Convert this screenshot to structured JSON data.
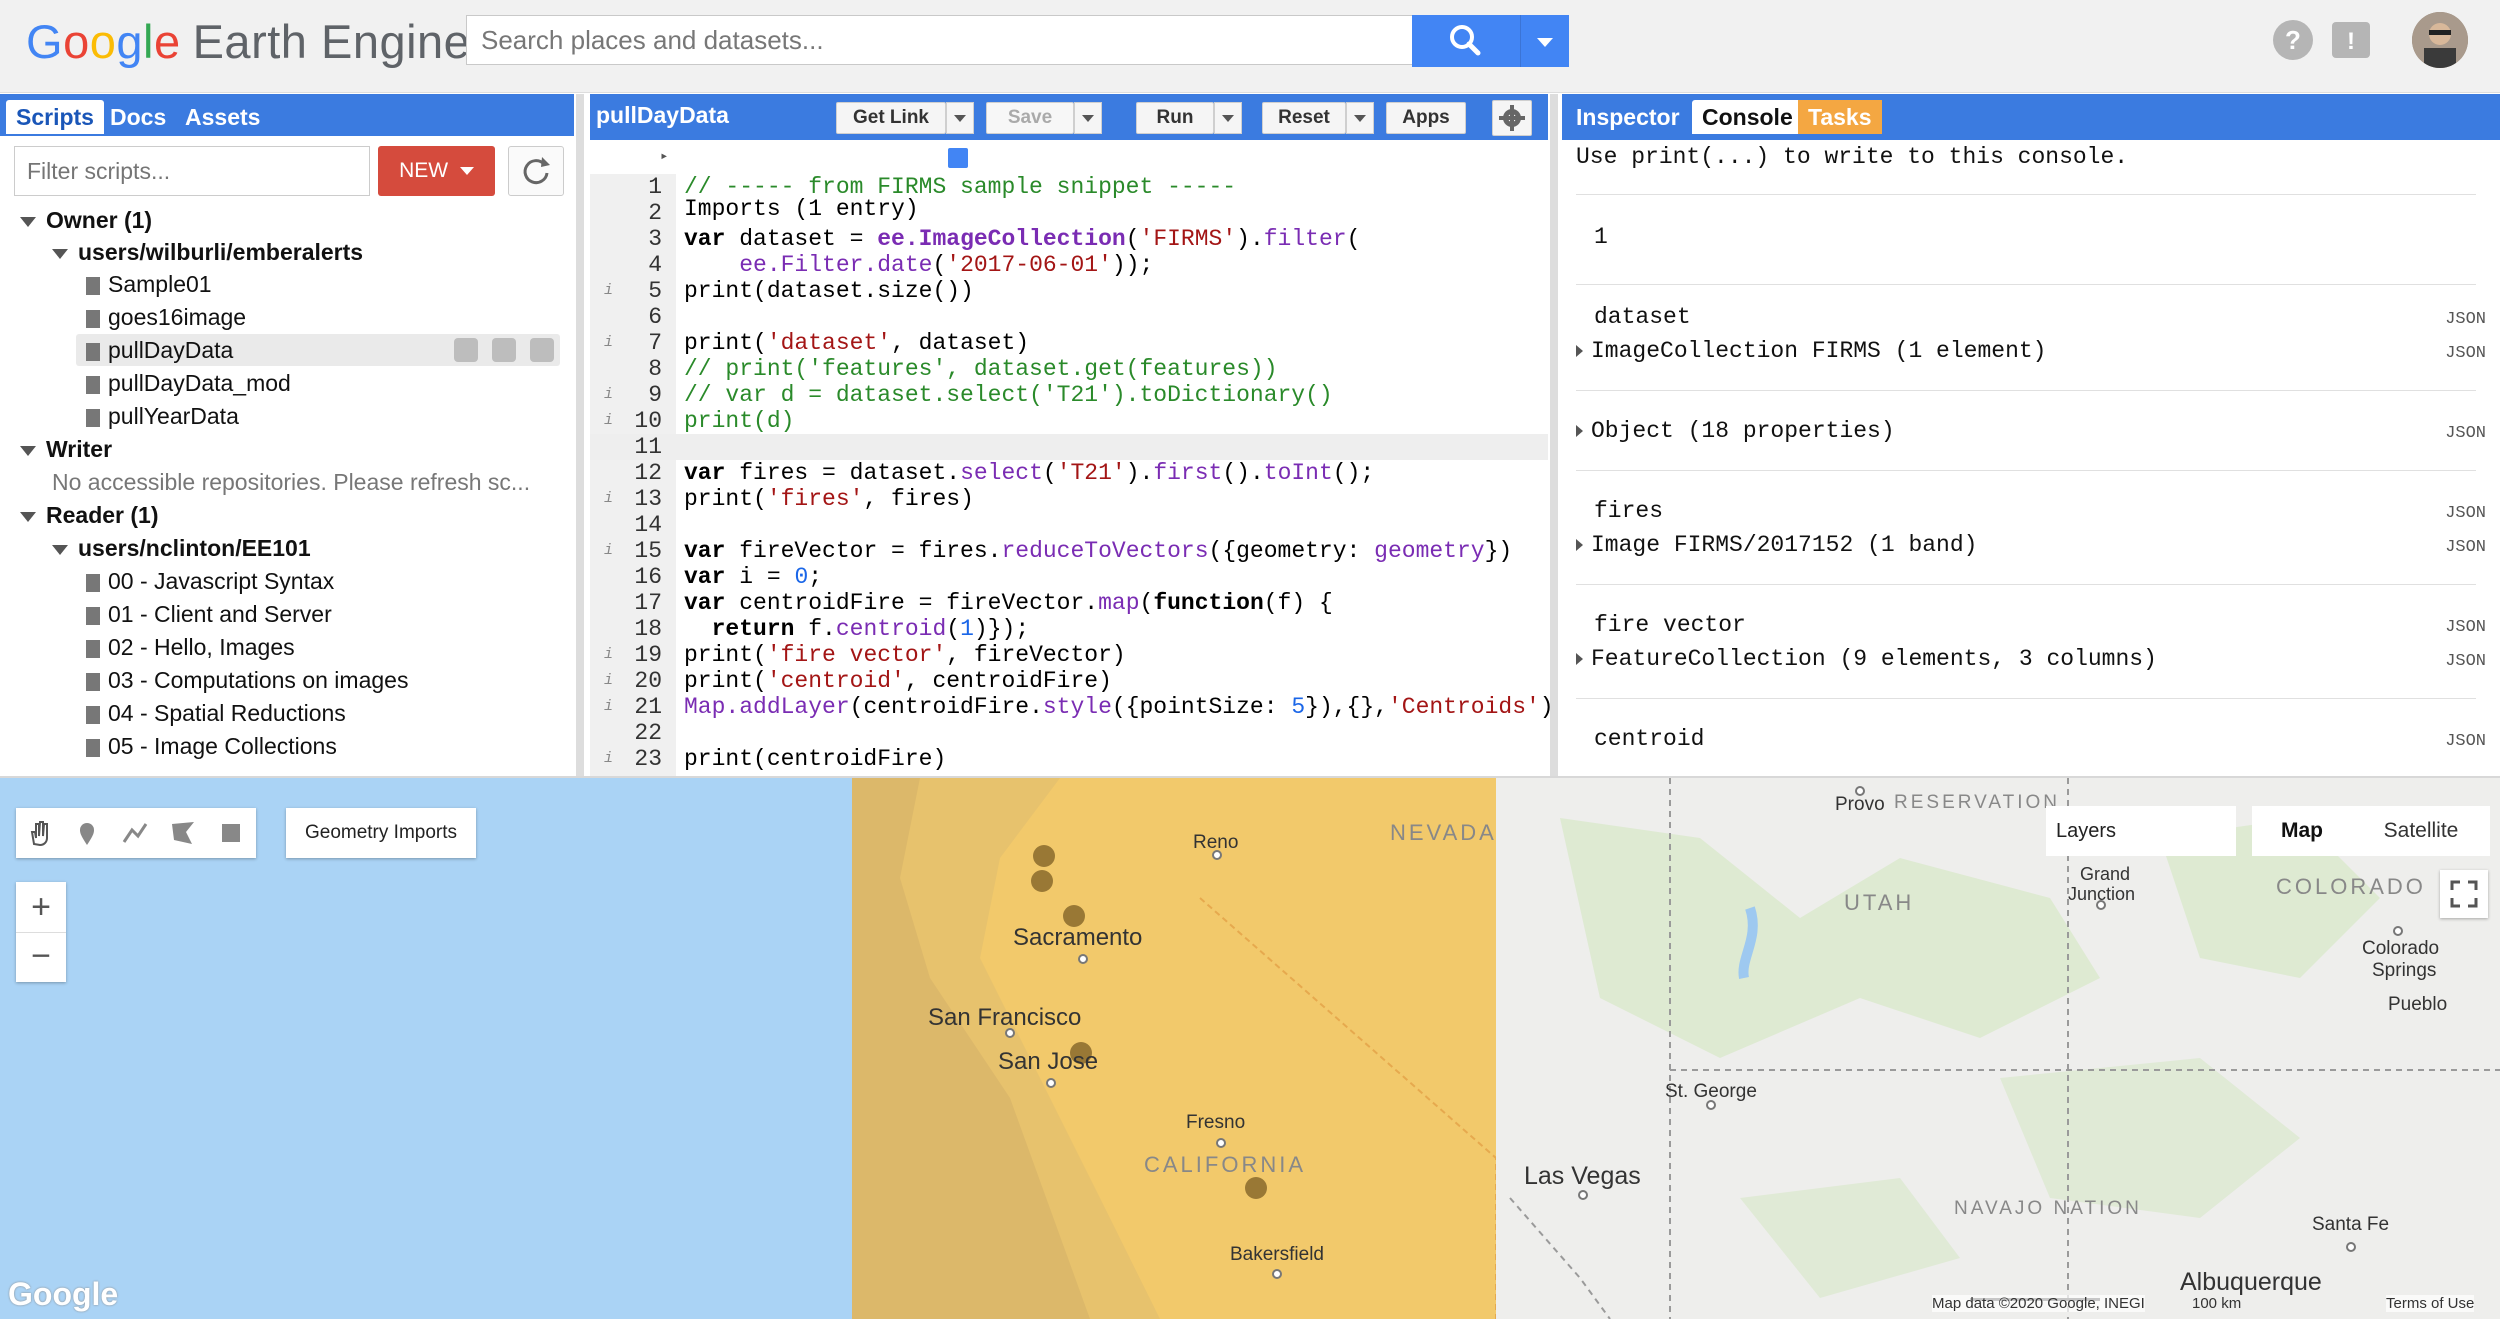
{
  "header": {
    "logo_google": [
      "G",
      "o",
      "o",
      "g",
      "l",
      "e"
    ],
    "logo_product": "Earth Engine",
    "search_placeholder": "Search places and datasets..."
  },
  "left_panel": {
    "tabs": [
      "Scripts",
      "Docs",
      "Assets"
    ],
    "filter_placeholder": "Filter scripts...",
    "new_label": "NEW",
    "tree": [
      {
        "label": "Owner",
        "count": "(1)"
      },
      {
        "label": "users/wilburli/emberalerts"
      },
      {
        "label": "Sample01"
      },
      {
        "label": "goes16image"
      },
      {
        "label": "pullDayData"
      },
      {
        "label": "pullDayData_mod"
      },
      {
        "label": "pullYearData"
      },
      {
        "label": "Writer"
      },
      {
        "label": "No accessible repositories. Please refresh sc..."
      },
      {
        "label": "Reader",
        "count": "(1)"
      },
      {
        "label": "users/nclinton/EE101"
      },
      {
        "label": "00 - Javascript Syntax"
      },
      {
        "label": "01 - Client and Server"
      },
      {
        "label": "02 - Hello, Images"
      },
      {
        "label": "03 - Computations on images"
      },
      {
        "label": "04 - Spatial Reductions"
      },
      {
        "label": "05 - Image Collections"
      }
    ]
  },
  "editor": {
    "title": "pullDayData",
    "buttons": {
      "get_link": "Get Link",
      "save": "Save",
      "run": "Run",
      "reset": "Reset",
      "apps": "Apps"
    },
    "imports_label": "Imports (1 entry)",
    "lines": [
      "1",
      "2",
      "3",
      "4",
      "5",
      "6",
      "7",
      "8",
      "9",
      "10",
      "11",
      "12",
      "13",
      "14",
      "15",
      "16",
      "17",
      "18",
      "19",
      "20",
      "21",
      "22",
      "23"
    ]
  },
  "console": {
    "tabs": [
      "Inspector",
      "Console",
      "Tasks"
    ],
    "hint": "Use print(...) to write to this console.",
    "json_label": "JSON",
    "entries": [
      {
        "value": "1"
      },
      {
        "title": "dataset",
        "value": "ImageCollection FIRMS (1 element)"
      },
      {
        "value": "Object (18 properties)"
      },
      {
        "title": "fires",
        "value": "Image FIRMS/2017152 (1 band)"
      },
      {
        "title": "fire vector",
        "value": "FeatureCollection (9 elements, 3 columns)"
      },
      {
        "title": "centroid"
      }
    ]
  },
  "map": {
    "geometry_imports": "Geometry Imports",
    "layers": "Layers",
    "map_type": "Map",
    "satellite": "Satellite",
    "zoom_in": "+",
    "zoom_out": "−",
    "google": "Google",
    "attribution": "Map data ©2020 Google, INEGI",
    "scale": "100 km",
    "terms": "Terms of Use",
    "labels": {
      "reno": "Reno",
      "nevada": "NEVADA",
      "sacramento": "Sacramento",
      "san_francisco": "San Francisco",
      "san_jose": "San Jose",
      "fresno": "Fresno",
      "california": "CALIFORNIA",
      "bakersfield": "Bakersfield",
      "provo": "Provo",
      "reservation": "RESERVATION",
      "utah": "UTAH",
      "grand": "Grand",
      "junction": "Junction",
      "colorado": "COLORADO",
      "colorado_springs_1": "Colorado",
      "colorado_springs_2": "Springs",
      "pueblo": "Pueblo",
      "st_george": "St. George",
      "las_vegas": "Las Vegas",
      "navajo": "NAVAJO NATION",
      "santa_fe": "Santa Fe",
      "albuquerque": "Albuquerque"
    }
  }
}
